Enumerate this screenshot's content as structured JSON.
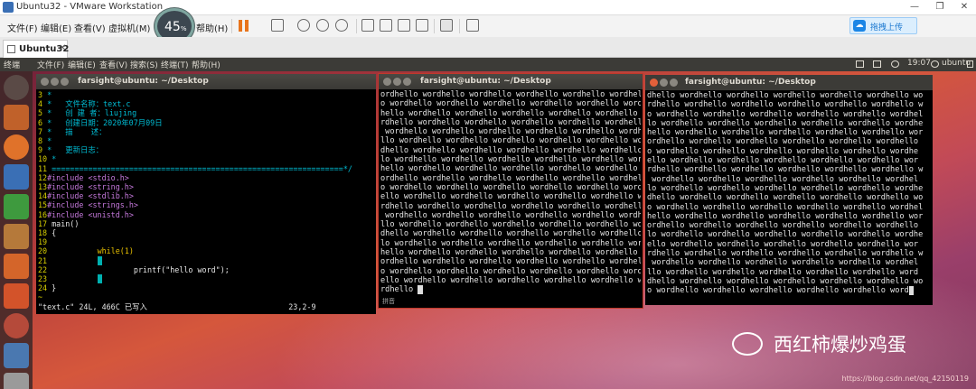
{
  "vm": {
    "title": "Ubuntu32 - VMware Workstation",
    "minimize": "—",
    "restore": "❐",
    "close": "✕",
    "menu": [
      "文件(F)",
      "编辑(E)",
      "查看(V)",
      "虚拟机(M)",
      "帮助(H)"
    ],
    "perf_value": "45",
    "perf_unit": "%",
    "upload_label": "拖拽上传",
    "tab_label": "Ubuntu32",
    "tab_close": "✕"
  },
  "ubuntu": {
    "app_name": "终端",
    "menu": [
      "文件(F)",
      "编辑(E)",
      "查看(V)",
      "搜索(S)",
      "终端(T)",
      "帮助(H)"
    ],
    "clock": "19:07",
    "user": "ubuntu"
  },
  "term1": {
    "title": "farsight@ubuntu: ~/Desktop",
    "lines": [
      [
        "3",
        " *",
        ""
      ],
      [
        "4",
        " *   文件名称：text.c",
        ""
      ],
      [
        "5",
        " *   创 建 者：liujing",
        ""
      ],
      [
        "6",
        " *   创建日期：2020年07月09日",
        ""
      ],
      [
        "7",
        " *   描    述：",
        ""
      ],
      [
        "8",
        " *",
        ""
      ],
      [
        "9",
        " *   更新日志：",
        ""
      ],
      [
        "10",
        " *",
        ""
      ],
      [
        "11",
        " ================================================================*/",
        ""
      ]
    ],
    "includes": [
      [
        "12",
        "#include <stdio.h>"
      ],
      [
        "13",
        "#include <string.h>"
      ],
      [
        "14",
        "#include <stdlib.h>"
      ],
      [
        "15",
        "#include <strings.h>"
      ],
      [
        "16",
        "#include <unistd.h>"
      ]
    ],
    "main": [
      "17",
      "main()"
    ],
    "brace_open": [
      "18",
      "{"
    ],
    "ln19": "19",
    "while_ln": "20",
    "while_code": "while(1)",
    "ln21": "21",
    "printf_ln": "22",
    "printf_code": "printf(\"hello word\");",
    "ln23": "23",
    "brace_close": [
      "24",
      "}"
    ],
    "tilde": "~",
    "status_left": "\"text.c\" 24L, 466C 已写入",
    "status_right": "23,2-9"
  },
  "term2": {
    "title": "farsight@ubuntu: ~/Desktop",
    "lines": [
      "ordhello wordhello wordhello wordhello wordhello wordhel",
      "o wordhello wordhello wordhello wordhello wordhello wordh",
      "hello wordhello wordhello wordhello wordhello wordhello w",
      "rdhello wordhello wordhello wordhello wordhello wordhello",
      " wordhello wordhello wordhello wordhello wordhello wordhe",
      "llo wordhello wordhello wordhello wordhello wordhello wor",
      "dhello wordhello wordhello wordhello wordhello wordhello",
      "lo wordhello wordhello wordhello wordhello wordhello wordh",
      "hello wordhello wordhello wordhello wordhello wordhello w",
      "ordhello wordhello wordhello wordhello wordhello wordhell",
      "o wordhello wordhello wordhello wordhello wordhello wordh",
      "ello wordhello wordhello wordhello wordhello wordhello wo",
      "rdhello wordhello wordhello wordhello wordhello wordhello",
      " wordhello wordhello wordhello wordhello wordhello wordhe",
      "llo wordhello wordhello wordhello wordhello wordhello wor",
      "dhello wordhello wordhello wordhello wordhello wordhello",
      "lo wordhello wordhello wordhello wordhello wordhello wordh",
      "hello wordhello wordhello wordhello wordhello wordhello w",
      "ordhello wordhello wordhello wordhello wordhello wordhell",
      "o wordhello wordhello wordhello wordhello wordhello wordh",
      "ello wordhello wordhello wordhello wordhello wordhello wo",
      "rdhello "
    ],
    "ime": "拼音"
  },
  "term3": {
    "title": "farsight@ubuntu: ~/Desktop",
    "lines": [
      "dhello wordhello wordhello wordhello wordhello wordhello wo",
      "rdhello wordhello wordhello wordhello wordhello wordhello w",
      "o wordhello wordhello wordhello wordhello wordhello wordhel",
      "lo wordhello wordhello wordhello wordhello wordhello wordhe",
      "hello wordhello wordhello wordhello wordhello wordhello wor",
      "ordhello wordhello wordhello wordhello wordhello wordhello",
      "o wordhello wordhello wordhello wordhello wordhello wordhe",
      "ello wordhello wordhello wordhello wordhello wordhello wor",
      "rdhello wordhello wordhello wordhello wordhello wordhello w",
      " wordhello wordhello wordhello wordhello wordhello wordhel",
      "lo wordhello wordhello wordhello wordhello wordhello wordhe",
      "dhello wordhello wordhello wordhello wordhello wordhello wo",
      "o wordhello wordhello wordhello wordhello wordhello wordhel",
      "hello wordhello wordhello wordhello wordhello wordhello wor",
      "ordhello wordhello wordhello wordhello wordhello wordhello",
      "lo wordhello wordhello wordhello wordhello wordhello wordhe",
      "ello wordhello wordhello wordhello wordhello wordhello wor",
      "rdhello wordhello wordhello wordhello wordhello wordhello w",
      " wordhello wordhello wordhello wordhello wordhello wordhel",
      "llo wordhello wordhello wordhello wordhello wordhello word",
      "dhello wordhello wordhello wordhello wordhello wordhello wo",
      "o wordhello wordhello wordhello wordhello wordhello word"
    ]
  },
  "watermark": "西红柿爆炒鸡蛋",
  "blog_url": "https://blog.csdn.net/qq_42150119"
}
